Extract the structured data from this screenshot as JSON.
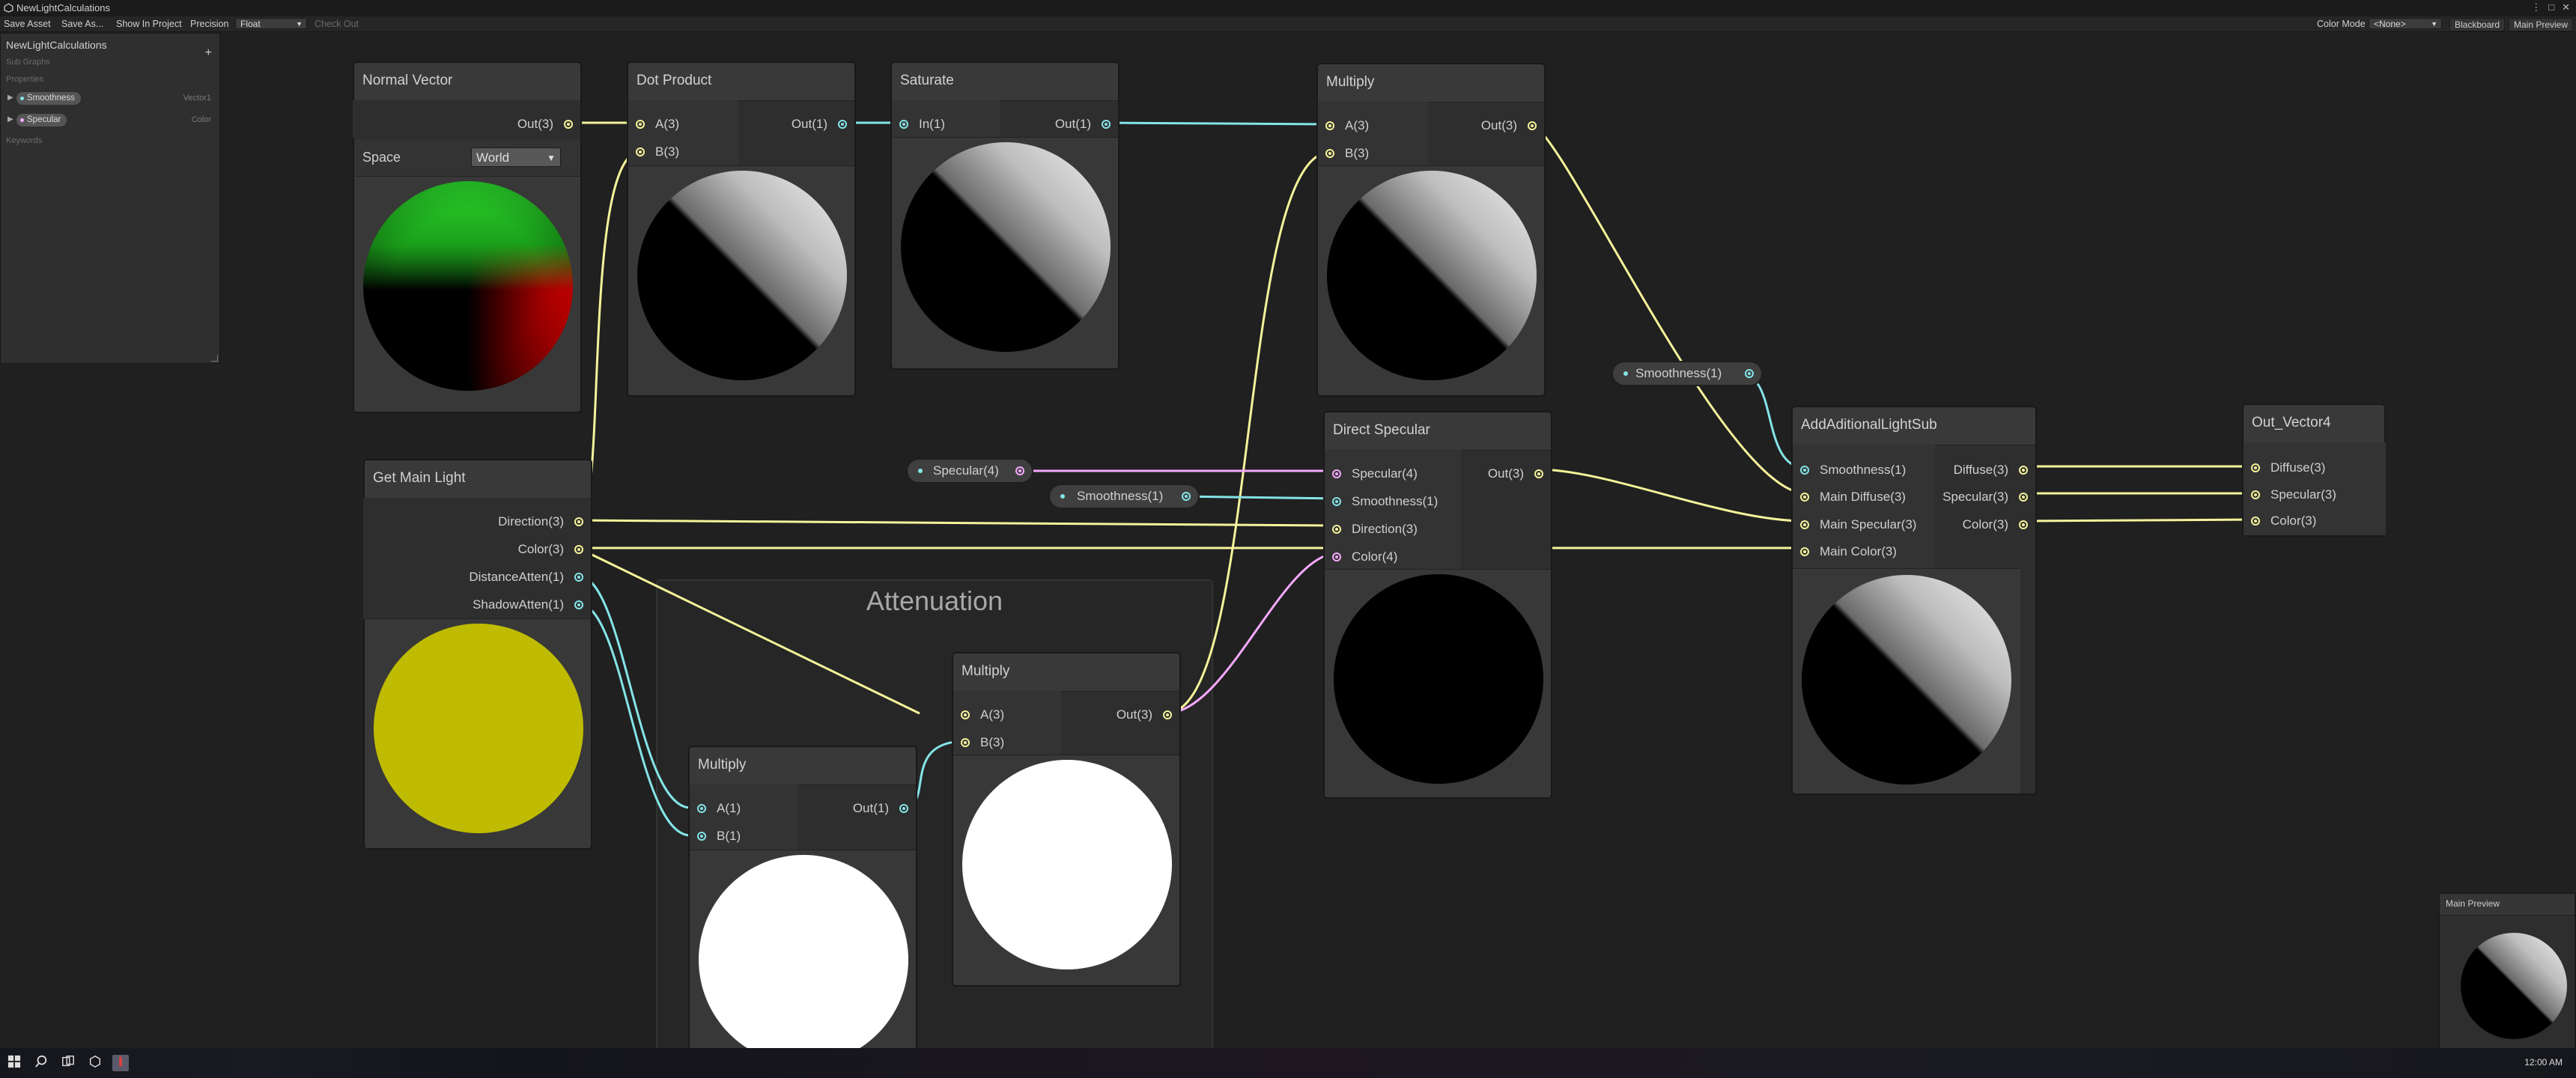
{
  "window": {
    "title": "NewLightCalculations"
  },
  "toolbar": {
    "save_asset": "Save Asset",
    "save_as": "Save As...",
    "show_in_project": "Show In Project",
    "precision_label": "Precision",
    "precision_value": "Float",
    "check_out": "Check Out",
    "color_mode_label": "Color Mode",
    "color_mode_value": "<None>",
    "blackboard": "Blackboard",
    "main_preview": "Main Preview"
  },
  "blackboard": {
    "title": "NewLightCalculations",
    "subtitle": "Sub Graphs",
    "properties_label": "Properties",
    "keywords_label": "Keywords",
    "add": "+",
    "properties": [
      {
        "name": "Smoothness",
        "type": "Vector1",
        "color": "#84e4e7"
      },
      {
        "name": "Specular",
        "type": "Color",
        "color": "#f6a9ff"
      }
    ]
  },
  "nodes": {
    "normal_vector": {
      "title": "Normal Vector",
      "out": "Out(3)",
      "space_label": "Space",
      "space_value": "World"
    },
    "dot_product": {
      "title": "Dot Product",
      "a": "A(3)",
      "b": "B(3)",
      "out": "Out(1)"
    },
    "saturate": {
      "title": "Saturate",
      "in": "In(1)",
      "out": "Out(1)"
    },
    "multiply_top": {
      "title": "Multiply",
      "a": "A(3)",
      "b": "B(3)",
      "out": "Out(3)"
    },
    "get_main_light": {
      "title": "Get Main Light",
      "direction": "Direction(3)",
      "color": "Color(3)",
      "distance": "DistanceAtten(1)",
      "shadow": "ShadowAtten(1)"
    },
    "direct_specular": {
      "title": "Direct Specular",
      "specular": "Specular(4)",
      "smoothness": "Smoothness(1)",
      "direction": "Direction(3)",
      "color": "Color(4)",
      "out": "Out(3)"
    },
    "additional_light": {
      "title": "AddAditionalLightSub",
      "smoothness": "Smoothness(1)",
      "main_diffuse": "Main Diffuse(3)",
      "main_specular": "Main Specular(3)",
      "main_color": "Main Color(3)",
      "diffuse_out": "Diffuse(3)",
      "specular_out": "Specular(3)",
      "color_out": "Color(3)"
    },
    "out_vector4": {
      "title": "Out_Vector4",
      "diffuse": "Diffuse(3)",
      "specular": "Specular(3)",
      "color": "Color(3)"
    },
    "multiply_atten": {
      "title": "Multiply",
      "a": "A(1)",
      "b": "B(1)",
      "out": "Out(1)"
    },
    "multiply_mid": {
      "title": "Multiply",
      "a": "A(3)",
      "b": "B(3)",
      "out": "Out(3)"
    }
  },
  "property_nodes": {
    "smoothness_a": "Smoothness(1)",
    "specular": "Specular(4)",
    "smoothness_b": "Smoothness(1)"
  },
  "group": {
    "title": "Attenuation"
  },
  "main_preview": {
    "title": "Main Preview"
  },
  "taskbar": {
    "clock": "12:00 AM"
  },
  "colors": {
    "vec3": "#f5f39a",
    "vec1": "#84e4e7",
    "vec4": "#f6a9ff"
  }
}
